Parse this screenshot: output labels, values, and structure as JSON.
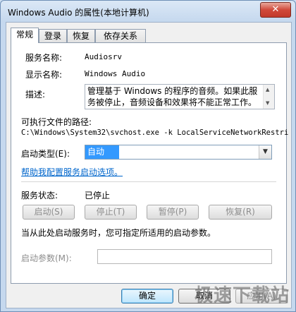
{
  "window": {
    "title": "Windows Audio 的属性(本地计算机)",
    "close_symbol": "✕"
  },
  "tabs": [
    {
      "label": "常规",
      "active": true
    },
    {
      "label": "登录",
      "active": false
    },
    {
      "label": "恢复",
      "active": false
    },
    {
      "label": "依存关系",
      "active": false
    }
  ],
  "general": {
    "service_name_label": "服务名称:",
    "service_name": "Audiosrv",
    "display_name_label": "显示名称:",
    "display_name": "Windows Audio",
    "description_label": "描述:",
    "description": "管理基于 Windows 的程序的音频。如果此服务被停止，音频设备和效果将不能正常工作。如",
    "exe_path_label": "可执行文件的路径:",
    "exe_path": "C:\\Windows\\System32\\svchost.exe -k LocalServiceNetworkRestri",
    "startup_type_label": "启动类型(E):",
    "startup_type_value": "自动",
    "help_link": "帮助我配置服务启动选项。",
    "status_label": "服务状态:",
    "status_value": "已停止",
    "buttons": {
      "start": "启动(S)",
      "stop": "停止(T)",
      "pause": "暂停(P)",
      "resume": "恢复(R)"
    },
    "hint": "当从此处启动服务时，您可指定所适用的启动参数。",
    "start_params_label": "启动参数(M):",
    "start_params_value": ""
  },
  "footer": {
    "ok": "确定",
    "cancel": "取消",
    "apply": "应用(A)"
  },
  "watermark": "极速下载站",
  "colors": {
    "link": "#0066cc",
    "selection": "#3399ff",
    "close": "#c23a2b"
  }
}
